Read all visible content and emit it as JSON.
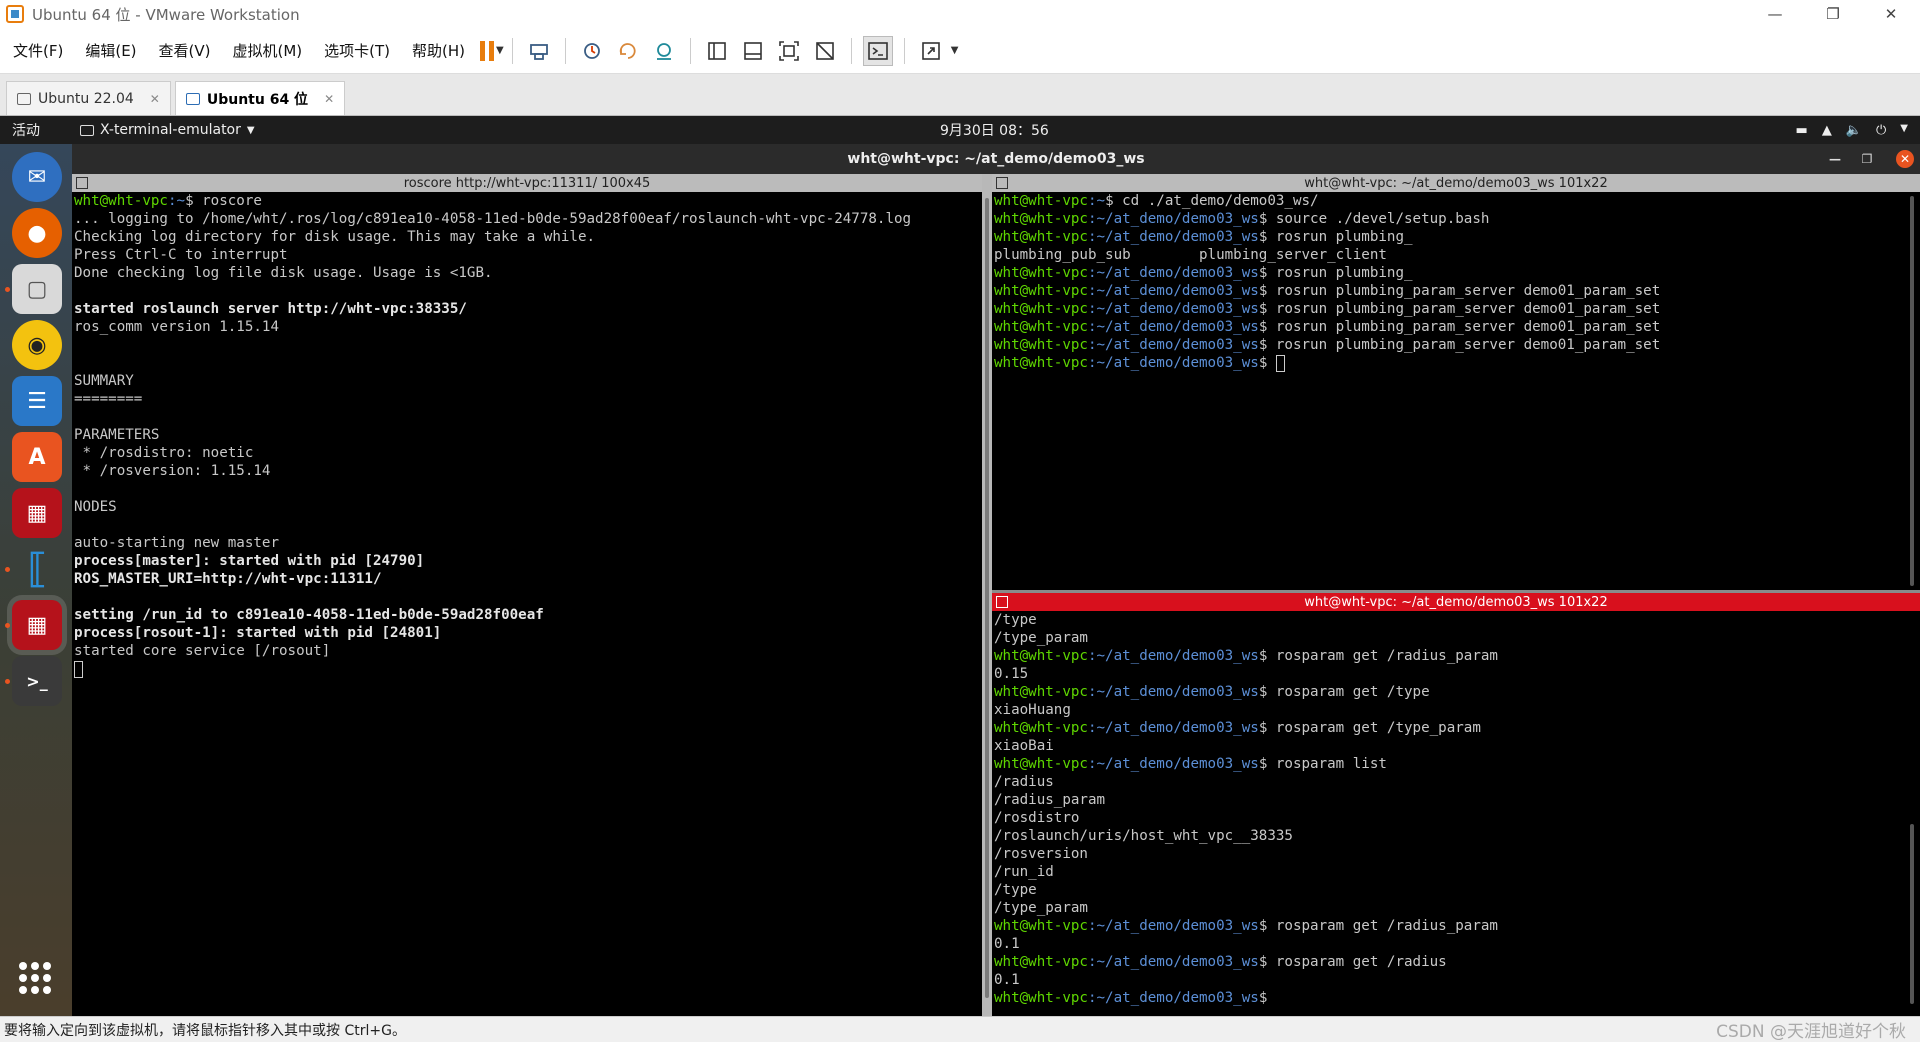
{
  "window": {
    "title": "Ubuntu 64 位 - VMware Workstation"
  },
  "menu": [
    "文件(F)",
    "编辑(E)",
    "查看(V)",
    "虚拟机(M)",
    "选项卡(T)",
    "帮助(H)"
  ],
  "tabs": [
    {
      "label": "Ubuntu 22.04",
      "active": false
    },
    {
      "label": "Ubuntu 64 位",
      "active": true
    }
  ],
  "gnome": {
    "activities": "活动",
    "app_menu": "X-terminal-emulator",
    "clock": "9月30日  08：56"
  },
  "terminal": {
    "title": "wht@wht-vpc: ~/at_demo/demo03_ws",
    "panes": {
      "left": {
        "title": "roscore http://wht-vpc:11311/ 100x45",
        "lines": [
          {
            "u": "wht@wht-vpc",
            "p": ":~",
            "t": "$ roscore"
          },
          {
            "t": "... logging to /home/wht/.ros/log/c891ea10-4058-11ed-b0de-59ad28f00eaf/roslaunch-wht-vpc-24778.log"
          },
          {
            "t": "Checking log directory for disk usage. This may take a while."
          },
          {
            "t": "Press Ctrl-C to interrupt"
          },
          {
            "t": "Done checking log file disk usage. Usage is <1GB."
          },
          {
            "t": ""
          },
          {
            "b": "started roslaunch server http://wht-vpc:38335/"
          },
          {
            "t": "ros_comm version 1.15.14"
          },
          {
            "t": ""
          },
          {
            "t": ""
          },
          {
            "t": "SUMMARY"
          },
          {
            "t": "========"
          },
          {
            "t": ""
          },
          {
            "t": "PARAMETERS"
          },
          {
            "t": " * /rosdistro: noetic"
          },
          {
            "t": " * /rosversion: 1.15.14"
          },
          {
            "t": ""
          },
          {
            "t": "NODES"
          },
          {
            "t": ""
          },
          {
            "t": "auto-starting new master"
          },
          {
            "b": "process[master]: started with pid [24790]"
          },
          {
            "b": "ROS_MASTER_URI=http://wht-vpc:11311/"
          },
          {
            "t": ""
          },
          {
            "b": "setting /run_id to c891ea10-4058-11ed-b0de-59ad28f00eaf"
          },
          {
            "b": "process[rosout-1]: started with pid [24801]"
          },
          {
            "t": "started core service [/rosout]"
          }
        ]
      },
      "top_right": {
        "title": "wht@wht-vpc: ~/at_demo/demo03_ws 101x22",
        "lines": [
          {
            "u": "wht@wht-vpc",
            "p": ":~",
            "t": "$ cd ./at_demo/demo03_ws/"
          },
          {
            "u": "wht@wht-vpc",
            "p": ":~/at_demo/demo03_ws",
            "t": "$ source ./devel/setup.bash"
          },
          {
            "u": "wht@wht-vpc",
            "p": ":~/at_demo/demo03_ws",
            "t": "$ rosrun plumbing_"
          },
          {
            "t": "plumbing_pub_sub        plumbing_server_client"
          },
          {
            "u": "wht@wht-vpc",
            "p": ":~/at_demo/demo03_ws",
            "t": "$ rosrun plumbing_"
          },
          {
            "u": "wht@wht-vpc",
            "p": ":~/at_demo/demo03_ws",
            "t": "$ rosrun plumbing_param_server demo01_param_set"
          },
          {
            "u": "wht@wht-vpc",
            "p": ":~/at_demo/demo03_ws",
            "t": "$ rosrun plumbing_param_server demo01_param_set"
          },
          {
            "u": "wht@wht-vpc",
            "p": ":~/at_demo/demo03_ws",
            "t": "$ rosrun plumbing_param_server demo01_param_set"
          },
          {
            "u": "wht@wht-vpc",
            "p": ":~/at_demo/demo03_ws",
            "t": "$ rosrun plumbing_param_server demo01_param_set"
          },
          {
            "u": "wht@wht-vpc",
            "p": ":~/at_demo/demo03_ws",
            "t": "$ ",
            "cursor": true
          }
        ]
      },
      "bottom_right": {
        "title": "wht@wht-vpc: ~/at_demo/demo03_ws 101x22",
        "lines": [
          {
            "t": "/type"
          },
          {
            "t": "/type_param"
          },
          {
            "u": "wht@wht-vpc",
            "p": ":~/at_demo/demo03_ws",
            "t": "$ rosparam get /radius_param"
          },
          {
            "t": "0.15"
          },
          {
            "u": "wht@wht-vpc",
            "p": ":~/at_demo/demo03_ws",
            "t": "$ rosparam get /type"
          },
          {
            "t": "xiaoHuang"
          },
          {
            "u": "wht@wht-vpc",
            "p": ":~/at_demo/demo03_ws",
            "t": "$ rosparam get /type_param"
          },
          {
            "t": "xiaoBai"
          },
          {
            "u": "wht@wht-vpc",
            "p": ":~/at_demo/demo03_ws",
            "t": "$ rosparam list"
          },
          {
            "t": "/radius"
          },
          {
            "t": "/radius_param"
          },
          {
            "t": "/rosdistro"
          },
          {
            "t": "/roslaunch/uris/host_wht_vpc__38335"
          },
          {
            "t": "/rosversion"
          },
          {
            "t": "/run_id"
          },
          {
            "t": "/type"
          },
          {
            "t": "/type_param"
          },
          {
            "u": "wht@wht-vpc",
            "p": ":~/at_demo/demo03_ws",
            "t": "$ rosparam get /radius_param"
          },
          {
            "t": "0.1"
          },
          {
            "u": "wht@wht-vpc",
            "p": ":~/at_demo/demo03_ws",
            "t": "$ rosparam get /radius"
          },
          {
            "t": "0.1"
          },
          {
            "u": "wht@wht-vpc",
            "p": ":~/at_demo/demo03_ws",
            "t": "$ "
          }
        ]
      }
    }
  },
  "status": {
    "message": "要将输入定向到该虚拟机，请将鼠标指针移入其中或按 Ctrl+G。",
    "watermark": "CSDN @天涯旭道好个秋"
  },
  "colors": {
    "accent": "#e87d0d",
    "active_pane": "#d8101d",
    "user_green": "#5fd700",
    "path_blue": "#5c8fd6"
  }
}
